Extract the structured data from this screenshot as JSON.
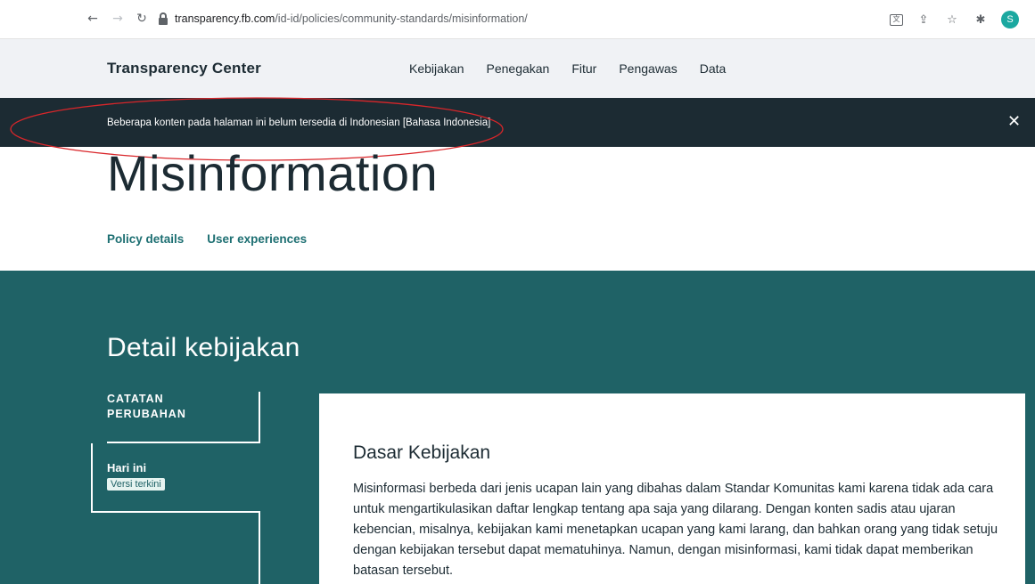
{
  "browser": {
    "url_domain": "transparency.fb.com",
    "url_path": "/id-id/policies/community-standards/misinformation/",
    "avatar_initial": "S"
  },
  "header": {
    "brand": "Transparency Center",
    "nav": [
      "Kebijakan",
      "Penegakan",
      "Fitur",
      "Pengawas",
      "Data"
    ]
  },
  "banner": {
    "text": "Beberapa konten pada halaman ini belum tersedia di Indonesian [Bahasa Indonesia]",
    "annotation_color": "#d9262a"
  },
  "page": {
    "title": "Misinformation",
    "tabs": [
      "Policy details",
      "User experiences"
    ]
  },
  "policy": {
    "heading": "Detail kebijakan",
    "changelog_label": "CATATAN PERUBAHAN",
    "today_label": "Hari ini",
    "latest_badge": "Versi terkini",
    "card_title": "Dasar Kebijakan",
    "card_body": "Misinformasi berbeda dari jenis ucapan lain yang dibahas dalam Standar Komunitas kami karena tidak ada cara untuk mengartikulasikan daftar lengkap tentang apa saja yang dilarang. Dengan konten sadis atau ujaran kebencian, misalnya, kebijakan kami menetapkan ucapan yang kami larang, dan bahkan orang yang tidak setuju dengan kebijakan tersebut dapat mematuhinya. Namun, dengan misinformasi, kami tidak dapat memberikan batasan tersebut."
  },
  "colors": {
    "header_bg": "#f0f2f5",
    "banner_bg": "#1c2b33",
    "teal_bg": "#1f6266",
    "tab_accent": "#1d6f72"
  }
}
